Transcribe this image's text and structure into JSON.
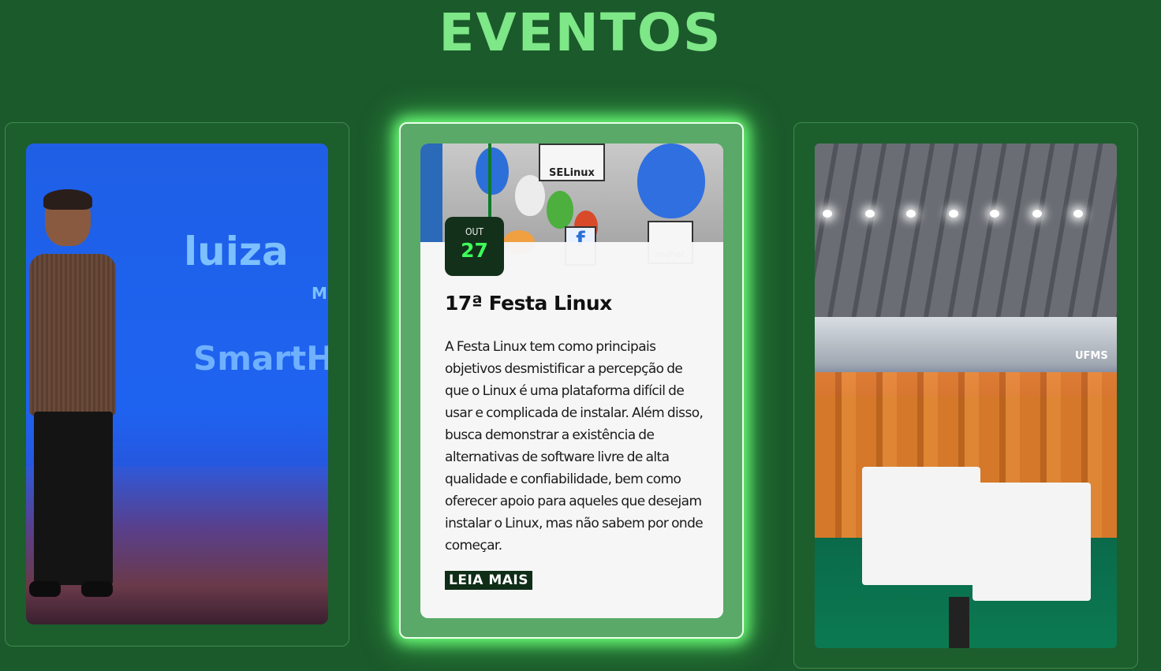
{
  "section": {
    "title": "EVENTOS"
  },
  "cards": {
    "left": {
      "screen_brand": "luiza",
      "screen_sub": "SmartH",
      "screen_m": "M"
    },
    "center": {
      "date_month": "OUT",
      "date_day": "27",
      "title": "17ª Festa Linux",
      "description": "A Festa Linux tem como principais objetivos desmistificar a percepção de que o Linux é uma plataforma difícil de usar e complicada de instalar. Além disso, busca demonstrar a existência de alternativas de software livre de alta qualidade e confiabilidade, bem como oferecer apoio para aqueles que desejam instalar o Linux, mas não sabem por onde começar.",
      "read_more": "LEIA MAIS",
      "photo_signs": {
        "selinux": "SELinux",
        "fedora": "f",
        "redhat": "redhat"
      }
    },
    "right": {
      "banner": "UFMS"
    }
  },
  "colors": {
    "background": "#1b5a2b",
    "title": "#7ee787",
    "glow": "#6dff78",
    "badge": "#13301a",
    "badge_day": "#3dff5a"
  }
}
